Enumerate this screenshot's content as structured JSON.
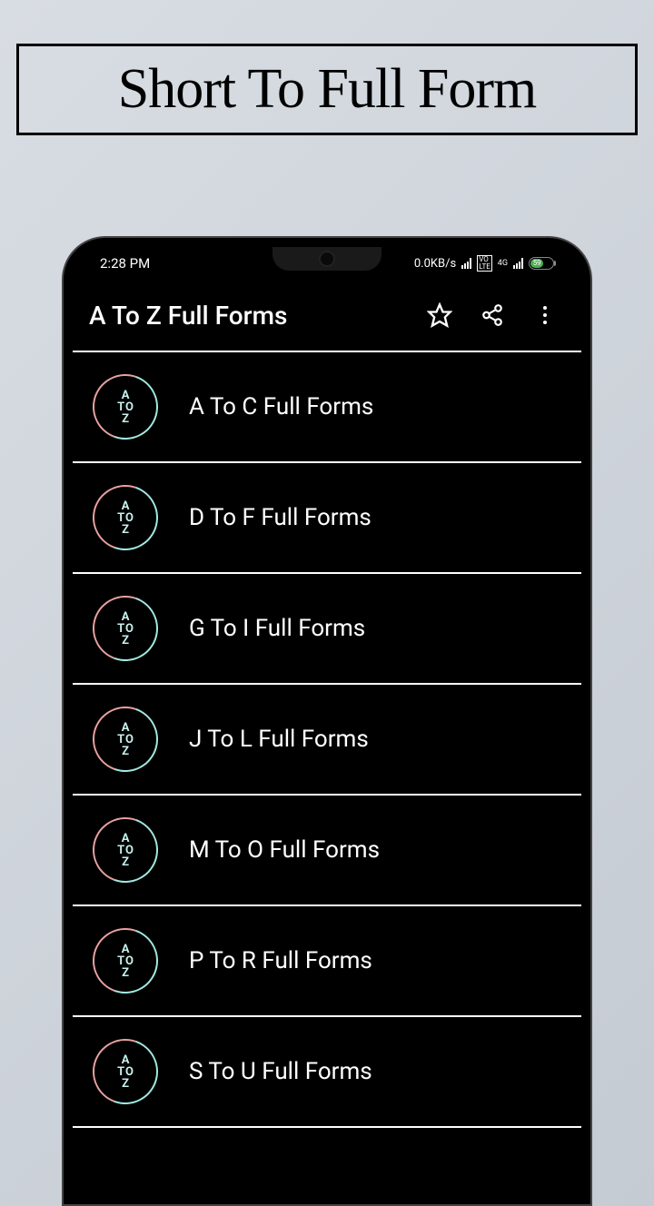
{
  "promo": {
    "title": "Short To Full Form"
  },
  "statusbar": {
    "time": "2:28 PM",
    "network_speed": "0.0KB/s",
    "volte": "VO\nLTE",
    "net_gen": "4G",
    "battery_pct": "59"
  },
  "appbar": {
    "title": "A To Z Full Forms"
  },
  "item_icon": {
    "line1": "A",
    "line2": "TO",
    "line3": "Z"
  },
  "items": [
    {
      "label": "A To C Full Forms"
    },
    {
      "label": "D To F Full Forms"
    },
    {
      "label": "G To I Full Forms"
    },
    {
      "label": "J To L Full Forms"
    },
    {
      "label": "M To O Full Forms"
    },
    {
      "label": "P To R Full Forms"
    },
    {
      "label": "S To U Full Forms"
    }
  ]
}
